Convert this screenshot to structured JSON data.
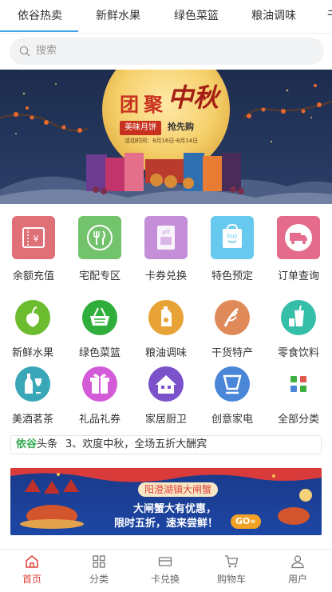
{
  "topnav": {
    "tabs": [
      {
        "label": "依谷热卖",
        "active": true
      },
      {
        "label": "新鲜水果"
      },
      {
        "label": "绿色菜篮"
      },
      {
        "label": "粮油调味"
      },
      {
        "label": "干"
      }
    ],
    "active_color": "#3fa7e8"
  },
  "search": {
    "placeholder": "搜索",
    "icon": "search-icon"
  },
  "banner": {
    "title_left": "团聚",
    "title_right": "中秋",
    "tag_left": "美味月饼",
    "tag_right": "抢先购",
    "period": "活动时间：8月16日-8月14日"
  },
  "services": [
    {
      "label": "余额充值",
      "icon": "recharge-card-icon",
      "color": "#e07077",
      "glyph": "¥"
    },
    {
      "label": "宅配专区",
      "icon": "fork-knife-icon",
      "color": "#72c36b"
    },
    {
      "label": "卡券兑换",
      "icon": "gift-card-icon",
      "color": "#c48ed8",
      "glyph": "gift"
    },
    {
      "label": "特色预定",
      "icon": "buy-bag-icon",
      "color": "#66c9ed",
      "glyph": "buy"
    },
    {
      "label": "订单查询",
      "icon": "delivery-truck-icon",
      "color": "#e46b8c"
    }
  ],
  "categories": [
    {
      "label": "新鲜水果",
      "icon": "apple-icon",
      "color": "#6cbc30"
    },
    {
      "label": "绿色菜篮",
      "icon": "basket-icon",
      "color": "#2fae3c"
    },
    {
      "label": "粮油调味",
      "icon": "oil-bottle-icon",
      "color": "#e8a336"
    },
    {
      "label": "干货特产",
      "icon": "dried-goods-icon",
      "color": "#e08a5a"
    },
    {
      "label": "零食饮料",
      "icon": "drink-cup-icon",
      "color": "#35bea8"
    },
    {
      "label": "美酒茗茶",
      "icon": "wine-bottle-icon",
      "color": "#3aa7b8"
    },
    {
      "label": "礼品礼券",
      "icon": "gift-box-icon",
      "color": "#d35bd7"
    },
    {
      "label": "家居厨卫",
      "icon": "house-icon",
      "color": "#7b52c9"
    },
    {
      "label": "创意家电",
      "icon": "monitor-icon",
      "color": "#4a86d8"
    },
    {
      "label": "全部分类",
      "icon": "grid-icon",
      "color": "#4aa56a"
    }
  ],
  "news": {
    "brand": "依谷",
    "label": "头条",
    "text": "3、欢度中秋，全场五折大酬宾"
  },
  "ad": {
    "headline": "阳澄湖镇大闸蟹",
    "line1": "大闸蟹大有优惠，",
    "line2": "限时五折，速来尝鲜！",
    "cta": "GO»"
  },
  "tabbar": [
    {
      "label": "首页",
      "icon": "home-icon",
      "active": true
    },
    {
      "label": "分类",
      "icon": "category-grid-icon"
    },
    {
      "label": "卡兑换",
      "icon": "card-icon"
    },
    {
      "label": "购物车",
      "icon": "cart-icon"
    },
    {
      "label": "用户",
      "icon": "user-icon"
    }
  ]
}
